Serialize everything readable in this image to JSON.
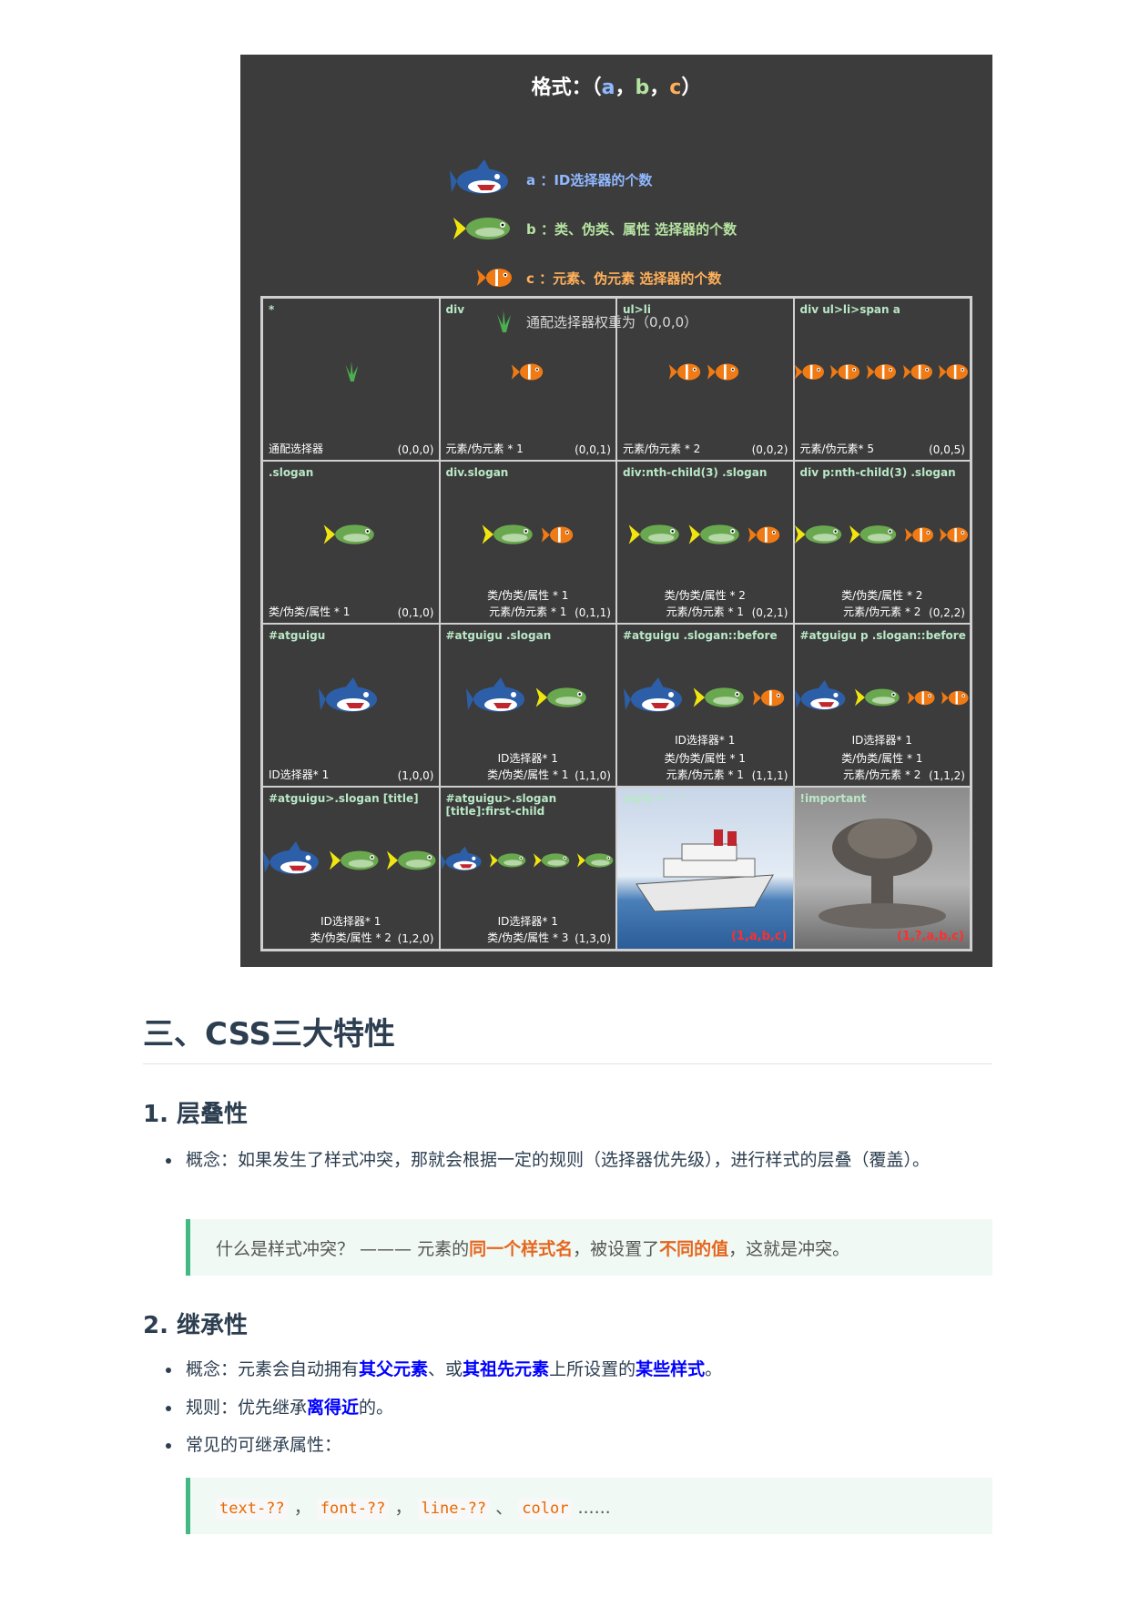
{
  "figure": {
    "title": {
      "prefix": "格式：（",
      "a": "a",
      "sep1": "，",
      "b": "b",
      "sep2": "，",
      "c": "c",
      "suffix": "）"
    },
    "legend": {
      "a": "a ：ID选择器的个数",
      "b": "b ：类、伪类、属性 选择器的个数",
      "c": "c ：元素、伪元素 选择器的个数",
      "star": "通配选择器权重为（0,0,0）"
    },
    "cells": [
      {
        "selector": "*",
        "lines": [
          "通配选择器"
        ],
        "value": "(0,0,0)"
      },
      {
        "selector": "div",
        "lines": [
          "元素/伪元素 * 1"
        ],
        "value": "(0,0,1)"
      },
      {
        "selector": "ul>li",
        "lines": [
          "元素/伪元素 * 2"
        ],
        "value": "(0,0,2)"
      },
      {
        "selector": "div ul>li>span a",
        "lines": [
          "元素/伪元素* 5"
        ],
        "value": "(0,0,5)"
      },
      {
        "selector": ".slogan",
        "lines": [
          "类/伪类/属性 * 1"
        ],
        "value": "(0,1,0)"
      },
      {
        "selector": "div.slogan",
        "lines": [
          "类/伪类/属性 * 1",
          "元素/伪元素 * 1"
        ],
        "value": "(0,1,1)"
      },
      {
        "selector": "div:nth-child(3) .slogan",
        "lines": [
          "类/伪类/属性 * 2",
          "元素/伪元素 * 1"
        ],
        "value": "(0,2,1)"
      },
      {
        "selector": "div p:nth-child(3) .slogan",
        "lines": [
          "类/伪类/属性 * 2",
          "元素/伪元素 * 2"
        ],
        "value": "(0,2,2)"
      },
      {
        "selector": "#atguigu",
        "lines": [
          "ID选择器* 1"
        ],
        "value": "(1,0,0)"
      },
      {
        "selector": "#atguigu .slogan",
        "lines": [
          "ID选择器* 1",
          "类/伪类/属性 * 1"
        ],
        "value": "(1,1,0)"
      },
      {
        "selector": "#atguigu .slogan::before",
        "lines": [
          "ID选择器* 1",
          "类/伪类/属性 * 1",
          "元素/伪元素 * 1"
        ],
        "value": "(1,1,1)"
      },
      {
        "selector": "#atguigu p .slogan::before",
        "lines": [
          "ID选择器* 1",
          "类/伪类/属性 * 1",
          "元素/伪元素 * 2"
        ],
        "value": "(1,1,2)"
      },
      {
        "selector": "#atguigu>.slogan [title]",
        "lines": [
          "ID选择器* 1",
          "类/伪类/属性 * 2"
        ],
        "value": "(1,2,0)"
      },
      {
        "selector": "#atguigu>.slogan [title]:first-child",
        "lines": [
          "ID选择器* 1",
          "类/伪类/属性 * 3"
        ],
        "value": "(1,3,0)"
      },
      {
        "selector": "style = \" \"",
        "lines": [],
        "value": "(1,a,b,c)"
      },
      {
        "selector": "!important",
        "lines": [],
        "value": "(1,?,a,b,c)"
      }
    ]
  },
  "article": {
    "h2": "三、CSS三大特性",
    "h3_1": "1. 层叠性",
    "li1": "概念：如果发生了样式冲突，那就会根据一定的规则（选择器优先级），进行样式的层叠（覆盖）。",
    "tip1": {
      "pre": "什么是样式冲突？  ———  元素的",
      "hl1": "同一个样式名",
      "mid": "，被设置了",
      "hl2": "不同的值",
      "post": "，这就是冲突。"
    },
    "h3_2": "2. 继承性",
    "li2": {
      "pre": "概念：元素会自动拥有",
      "hl1": "其父元素",
      "m1": "、或",
      "hl2": "其祖先元素",
      "m2": "上所设置的",
      "hl3": "某些样式",
      "post": "。"
    },
    "li3": {
      "pre": "规则：优先继承",
      "hl": "离得近",
      "post": "的。"
    },
    "li4": "常见的可继承属性：",
    "tip2": {
      "c1": "text-??",
      "s1": " ，",
      "c2": "font-??",
      "s2": " ，",
      "c3": "line-??",
      "s3": " 、",
      "c4": "color",
      "post": " ......"
    }
  },
  "icons": {
    "a": "shark-icon",
    "b": "green-fish-icon",
    "c": "orange-fish-icon",
    "star": "grass-icon"
  }
}
